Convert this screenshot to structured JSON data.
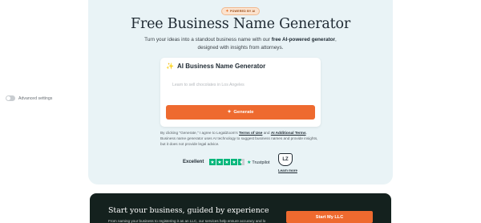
{
  "hero": {
    "badge": "POWERED BY AI",
    "title": "Free Business Name Generator",
    "subtitle_pre": "Turn your ideas into a standout business name with our ",
    "subtitle_bold": "free AI-powered generator",
    "subtitle_post": ", designed with insights from attorneys."
  },
  "generator": {
    "heading": "AI Business Name Generator",
    "input_placeholder": "Learn to sell chocolates in Los Angeles",
    "advanced_label": "Advanced settings",
    "generate_label": "Generate"
  },
  "legal": {
    "pre": "By clicking \"Generate,\" I agree to LegalZoom's ",
    "terms": "Terms of Use",
    "and": " and ",
    "ai_terms": "AI Additional Terms",
    "post": ". Business name generator uses AI technology to suggest business names and provide insights, but it does not provide legal advice."
  },
  "rating": {
    "label": "Excellent",
    "brand": "Trustpilot",
    "shield_text": "LZ",
    "learn_more": "Learn more",
    "stars": 4.5
  },
  "footer": {
    "title": "Start your business, guided by experience",
    "text": "From naming your business to registering it as an LLC, our services help ensure accuracy and lo",
    "cta": "Start My LLC"
  },
  "colors": {
    "accent": "#ee6a2f",
    "hero_bg": "#e9f3f6",
    "dark_bg": "#14211e",
    "trustpilot": "#00b67a"
  }
}
